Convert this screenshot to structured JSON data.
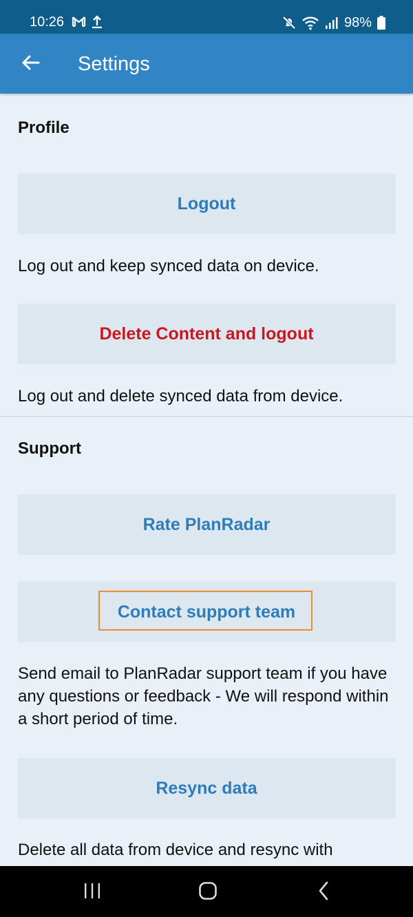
{
  "status_bar": {
    "time": "10:26",
    "battery": "98%",
    "icons": [
      "gmail-icon",
      "upload-icon",
      "mute-icon",
      "wifi-icon",
      "signal-icon",
      "battery-icon"
    ]
  },
  "header": {
    "title": "Settings",
    "back_icon": "arrow-left-icon"
  },
  "profile": {
    "title": "Profile",
    "logout_label": "Logout",
    "logout_desc": "Log out and keep synced data on device.",
    "delete_label": "Delete Content and logout",
    "delete_desc": "Log out and delete synced data from device."
  },
  "support": {
    "title": "Support",
    "rate_label": "Rate PlanRadar",
    "contact_label": "Contact support team",
    "contact_desc": "Send email to PlanRadar support team if you have any questions or feedback - We will respond within a short period of time.",
    "resync_label": "Resync data",
    "resync_desc": "Delete all data from device and resync with"
  },
  "colors": {
    "status_bar": "#0f5d8a",
    "app_bar": "#3185c4",
    "background": "#eaf0f8",
    "button_bg": "#dde7f0",
    "button_text": "#2e7cb8",
    "danger_text": "#c8171e",
    "focus_border": "#f08a2c"
  },
  "nav": {
    "icons": [
      "recent-apps-icon",
      "home-icon",
      "back-icon"
    ]
  }
}
